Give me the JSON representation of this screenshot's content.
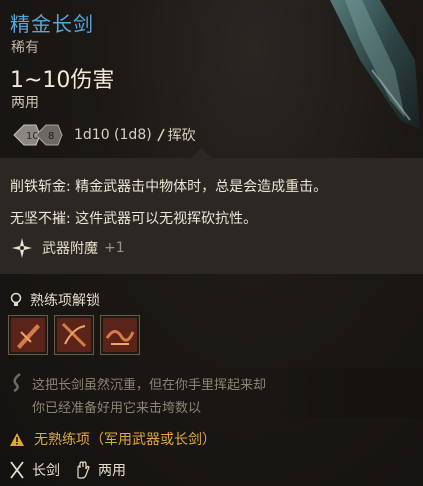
{
  "item": {
    "name": "精金长剑",
    "rarity": "稀有",
    "damage": "1~10伤害",
    "handedness": "两用",
    "dice_icons": [
      "d10-dice-icon",
      "d8-dice-icon"
    ],
    "dice_formula": "1d10 (1d8)",
    "damage_type": "挥砍"
  },
  "features": [
    "削铁斩金: 精金武器击中物体时，总是会造成重击。",
    "无坚不摧: 这件武器可以无视挥砍抗性。"
  ],
  "enchantment": {
    "icon": "enchant-sparkle-icon",
    "label": "武器附魔",
    "value": "+1"
  },
  "proficiency": {
    "title": "熟练项解锁",
    "icon": "lightbulb-icon",
    "actions": [
      {
        "icon": "action-slash-icon"
      },
      {
        "icon": "action-parry-icon"
      },
      {
        "icon": "action-flourish-icon"
      }
    ]
  },
  "description": {
    "line1": "这把长剑虽然沉重，但在你手里挥起来却",
    "line2": "你已经准备好用它来击垮数以"
  },
  "warning": {
    "icon": "warning-icon",
    "text": "无熟练项（军用武器或长剑）"
  },
  "footer": {
    "weapon_type": "长剑",
    "handed": "两用"
  },
  "colors": {
    "title": "#53a8dd",
    "warning": "#e0a739",
    "panel": "#2b2823",
    "background": "#15120f"
  }
}
